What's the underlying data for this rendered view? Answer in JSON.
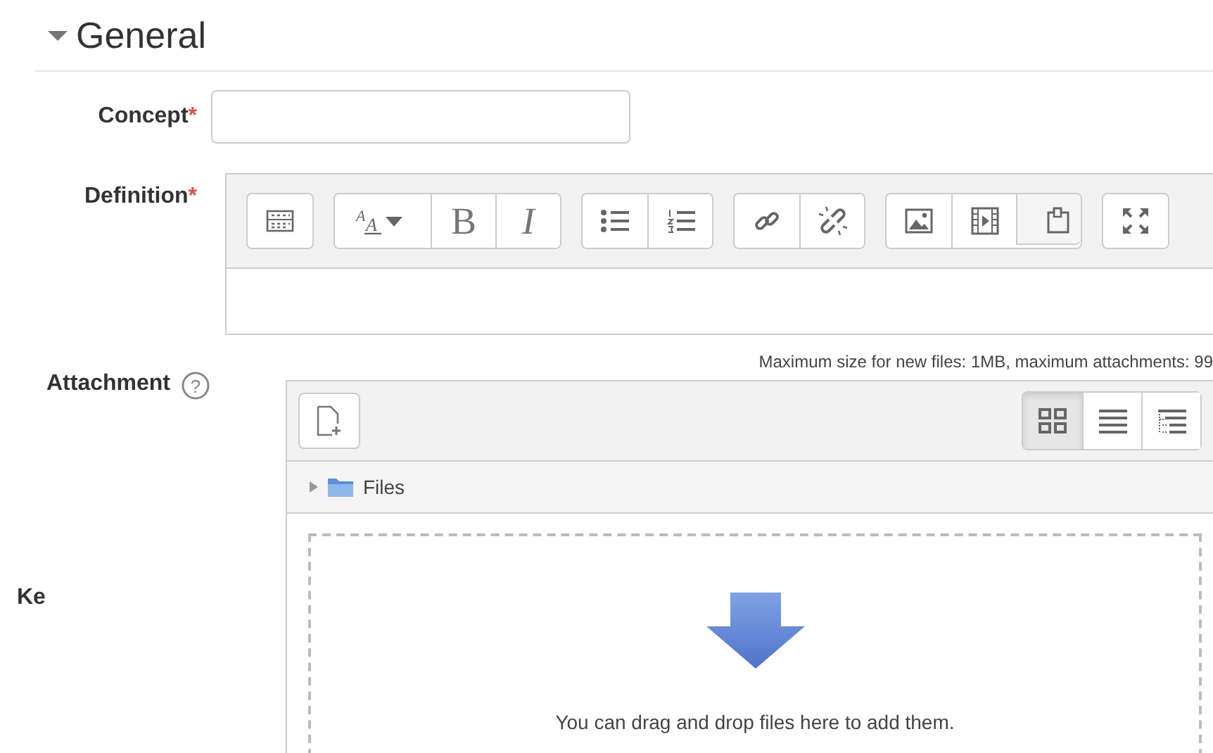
{
  "section": {
    "title": "General",
    "expanded": true
  },
  "concept": {
    "label": "Concept",
    "required": "*"
  },
  "definition": {
    "label": "Definition",
    "required": "*",
    "toolbar": [
      [
        {
          "kind": "collapse"
        }
      ],
      [
        {
          "kind": "style",
          "label": "A",
          "label_2": "A"
        },
        {
          "kind": "bold",
          "label": "B"
        },
        {
          "kind": "italic",
          "label": "I"
        }
      ],
      [
        {
          "kind": "bullets"
        },
        {
          "kind": "numbers"
        }
      ],
      [
        {
          "kind": "link"
        },
        {
          "kind": "unlink"
        }
      ],
      [
        {
          "kind": "image"
        },
        {
          "kind": "video"
        },
        {
          "kind": "files"
        }
      ],
      [
        {
          "kind": "fullscreen"
        }
      ]
    ]
  },
  "attachment": {
    "label": "Attachment",
    "help_mark": "?",
    "limits": "Maximum size for new files: 1MB, maximum attachments: 99",
    "views": [
      {
        "kind": "icons",
        "selected": true
      },
      {
        "kind": "list",
        "selected": false
      },
      {
        "kind": "tree",
        "selected": false
      }
    ],
    "folder": {
      "label": "Files",
      "expanded": false
    },
    "drop_hint": "You can drag and drop files here to add them."
  },
  "next_field": {
    "label": "Ke"
  }
}
